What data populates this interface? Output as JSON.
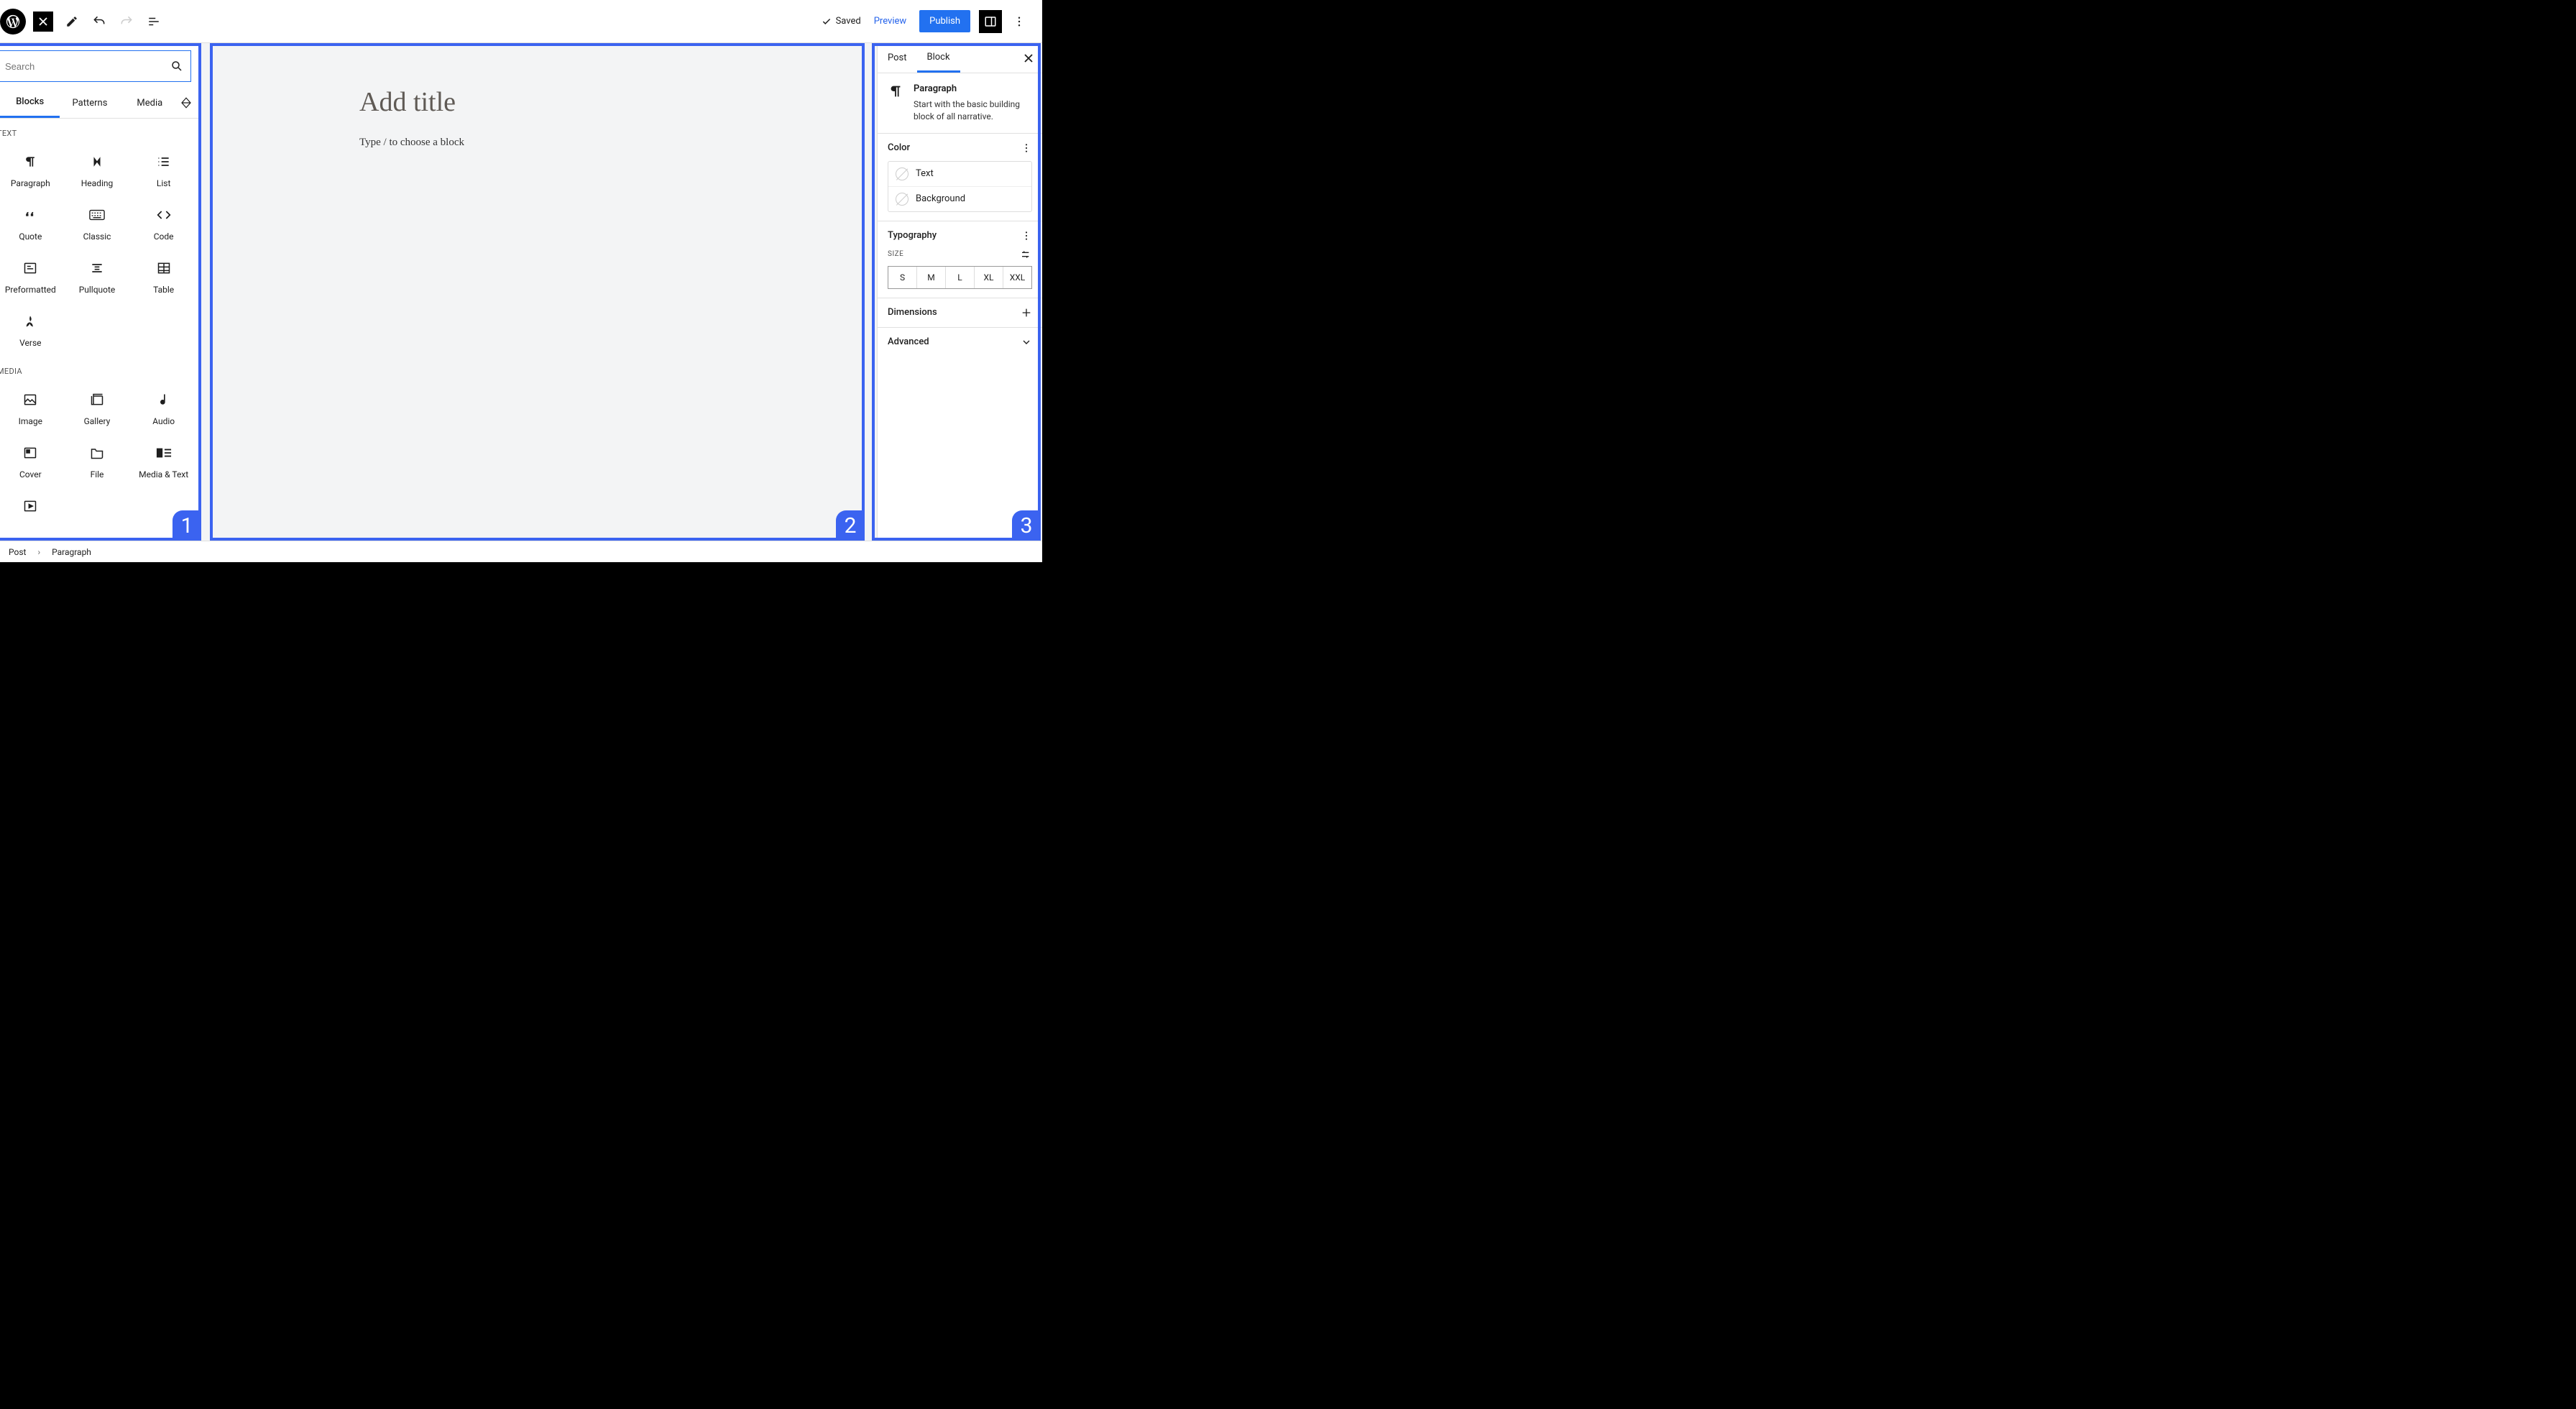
{
  "topbar": {
    "saved_label": "Saved",
    "preview_label": "Preview",
    "publish_label": "Publish"
  },
  "inserter": {
    "search_placeholder": "Search",
    "tabs": {
      "blocks": "Blocks",
      "patterns": "Patterns",
      "media": "Media"
    },
    "categories": {
      "text": {
        "label": "TEXT",
        "items": [
          {
            "label": "Paragraph"
          },
          {
            "label": "Heading"
          },
          {
            "label": "List"
          },
          {
            "label": "Quote"
          },
          {
            "label": "Classic"
          },
          {
            "label": "Code"
          },
          {
            "label": "Preformatted"
          },
          {
            "label": "Pullquote"
          },
          {
            "label": "Table"
          },
          {
            "label": "Verse"
          }
        ]
      },
      "media": {
        "label": "MEDIA",
        "items": [
          {
            "label": "Image"
          },
          {
            "label": "Gallery"
          },
          {
            "label": "Audio"
          },
          {
            "label": "Cover"
          },
          {
            "label": "File"
          },
          {
            "label": "Media & Text"
          }
        ]
      }
    }
  },
  "canvas": {
    "title_placeholder": "Add title",
    "block_placeholder": "Type / to choose a block"
  },
  "settings": {
    "tabs": {
      "post": "Post",
      "block": "Block"
    },
    "block_name": "Paragraph",
    "block_desc": "Start with the basic building block of all narrative.",
    "panels": {
      "color": {
        "title": "Color",
        "rows": {
          "text": "Text",
          "background": "Background"
        }
      },
      "typography": {
        "title": "Typography",
        "size_label": "SIZE",
        "sizes": [
          "S",
          "M",
          "L",
          "XL",
          "XXL"
        ]
      },
      "dimensions": {
        "title": "Dimensions"
      },
      "advanced": {
        "title": "Advanced"
      }
    }
  },
  "breadcrumb": {
    "post": "Post",
    "block": "Paragraph"
  },
  "regions": {
    "r1": "1",
    "r2": "2",
    "r3": "3"
  }
}
